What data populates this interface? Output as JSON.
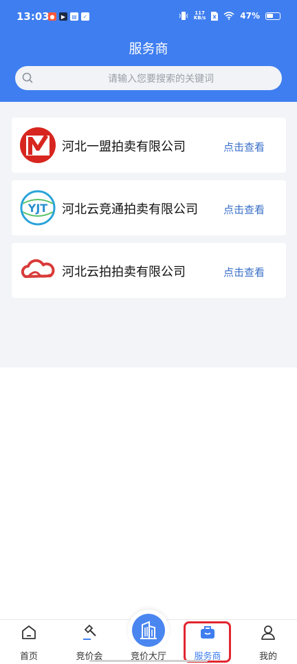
{
  "status_bar": {
    "time": "13:03",
    "net_speed_value": "117",
    "net_speed_unit": "KB/s",
    "battery": "47%"
  },
  "header": {
    "title": "服务商"
  },
  "search": {
    "placeholder": "请输入您要搜索的关键词"
  },
  "providers": [
    {
      "name": "河北一盟拍卖有限公司",
      "action": "点击查看",
      "logo": "yimeng-logo"
    },
    {
      "name": "河北云竞通拍卖有限公司",
      "action": "点击查看",
      "logo": "yunjingtong-logo"
    },
    {
      "name": "河北云拍拍卖有限公司",
      "action": "点击查看",
      "logo": "yunpai-cloud-logo"
    }
  ],
  "tabbar": {
    "items": [
      {
        "label": "首页",
        "icon": "home-icon"
      },
      {
        "label": "竞价会",
        "icon": "gavel-icon"
      },
      {
        "label": "竞价大厅",
        "icon": "building-icon"
      },
      {
        "label": "服务商",
        "icon": "briefcase-icon",
        "active": true
      },
      {
        "label": "我的",
        "icon": "user-icon"
      }
    ]
  },
  "colors": {
    "brand": "#3f7ef0",
    "link": "#3a6fc8",
    "highlight": "#e1252f"
  }
}
